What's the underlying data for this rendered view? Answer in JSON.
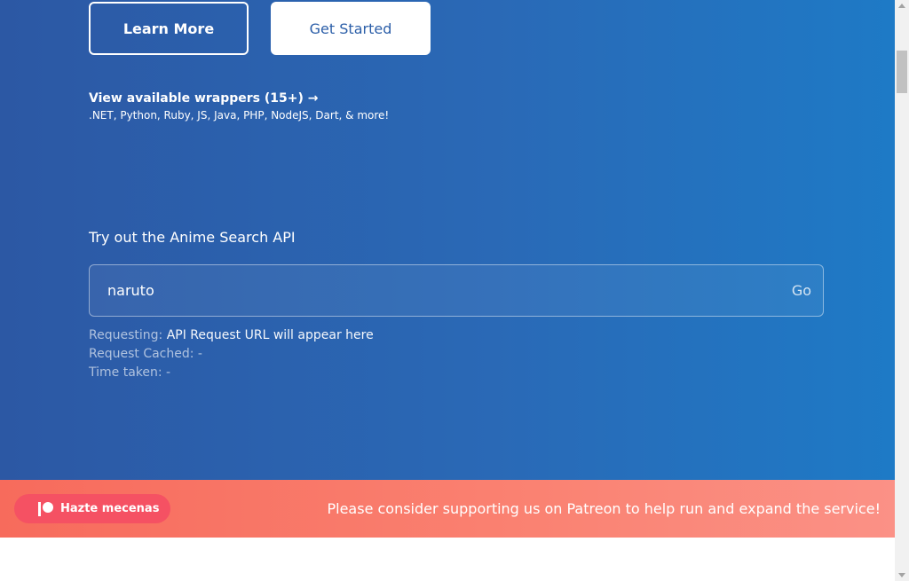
{
  "hero": {
    "learn_more_label": "Learn More",
    "get_started_label": "Get Started",
    "wrappers_link": "View available wrappers (15+) →",
    "wrappers_list": ".NET, Python, Ruby, JS, Java, PHP, NodeJS, Dart, & more!"
  },
  "search": {
    "heading": "Try out the Anime Search API",
    "input_value": "naruto",
    "go_label": "Go"
  },
  "request_info": {
    "requesting_label": "Requesting:",
    "requesting_value": "API Request URL will appear here",
    "cached_label": "Request Cached:",
    "cached_value": "-",
    "time_label": "Time taken:",
    "time_value": "-"
  },
  "patreon": {
    "button_label": "Hazte mecenas",
    "icon": "patreon-icon",
    "message": "Please consider supporting us on Patreon to help run and expand the service!"
  },
  "colors": {
    "hero_gradient_start": "#2c58a4",
    "hero_gradient_end": "#1e7ac6",
    "patreon_bar": "#f76b5c",
    "patreon_button": "#f55163"
  }
}
